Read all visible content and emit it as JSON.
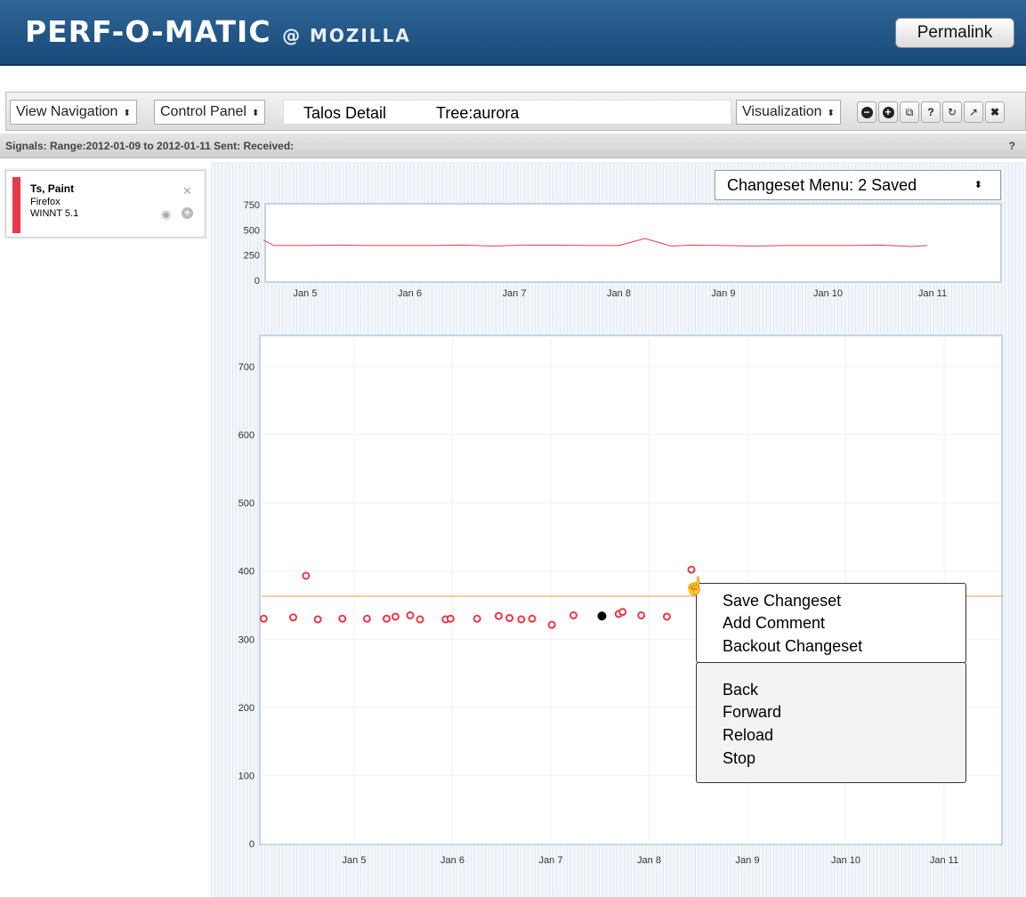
{
  "header": {
    "logo_main": "PERF-O-MATIC",
    "logo_sub": "@ MOZILLA",
    "permalink_label": "Permalink"
  },
  "toolbar": {
    "view_navigation": "View Navigation",
    "control_panel": "Control Panel",
    "title_left": "Talos Detail",
    "title_right": "Tree:aurora",
    "visualization": "Visualization",
    "icons": [
      "minus-circle-icon",
      "plus-circle-icon",
      "window-icon",
      "help-icon",
      "refresh-icon",
      "popout-icon",
      "close-icon"
    ],
    "help_label": "?"
  },
  "signals": {
    "text": "Signals: Range:2012-01-09 to 2012-01-11   Sent:   Received:",
    "help": "?"
  },
  "series": {
    "name": "Ts, Paint",
    "product": "Firefox",
    "platform": "WINNT 5.1",
    "color": "#e8394a"
  },
  "changeset_menu": {
    "label": "Changeset Menu: 2 Saved"
  },
  "context_menu": {
    "group1": [
      "Save Changeset",
      "Add Comment",
      "Backout Changeset"
    ],
    "group2": [
      "Back",
      "Forward",
      "Reload",
      "Stop"
    ]
  },
  "chart_data": [
    {
      "type": "line",
      "x_ticks": [
        "Jan 5",
        "Jan 6",
        "Jan 7",
        "Jan 8",
        "Jan 9",
        "Jan 10",
        "Jan 11"
      ],
      "y_ticks": [
        0,
        250,
        500,
        750
      ],
      "ylim": [
        0,
        750
      ],
      "series": [
        {
          "x": [
            4.6,
            4.7,
            5.0,
            5.3,
            5.6,
            5.9,
            6.2,
            6.5,
            6.8,
            7.1,
            7.4,
            7.7,
            8.0,
            8.25,
            8.5,
            8.7,
            9.0,
            9.3,
            9.6,
            9.9,
            10.2,
            10.5,
            10.8,
            10.95
          ],
          "values": [
            400,
            345,
            345,
            350,
            345,
            345,
            345,
            350,
            340,
            350,
            350,
            345,
            345,
            415,
            340,
            350,
            345,
            340,
            345,
            345,
            345,
            350,
            335,
            345
          ]
        }
      ]
    },
    {
      "type": "scatter",
      "x_ticks": [
        "Jan 5",
        "Jan 6",
        "Jan 7",
        "Jan 8",
        "Jan 9",
        "Jan 10",
        "Jan 11"
      ],
      "y_ticks": [
        0,
        100,
        200,
        300,
        400,
        500,
        600,
        700
      ],
      "ylim": [
        0,
        760
      ],
      "reference_line": 363,
      "series": [
        {
          "x": [
            4.08,
            4.38,
            4.51,
            4.63,
            4.88,
            5.13,
            5.33,
            5.42,
            5.57,
            5.67,
            5.93,
            5.98,
            6.25,
            6.47,
            6.58,
            6.7,
            6.81,
            7.01,
            7.23,
            7.69,
            7.73,
            7.92,
            8.18,
            8.43
          ],
          "values": [
            330,
            332,
            393,
            329,
            330,
            330,
            330,
            333,
            335,
            329,
            329,
            330,
            330,
            334,
            331,
            329,
            330,
            321,
            335,
            337,
            340,
            335,
            333,
            402
          ]
        },
        {
          "x": [
            7.52
          ],
          "values": [
            334
          ]
        }
      ]
    }
  ]
}
